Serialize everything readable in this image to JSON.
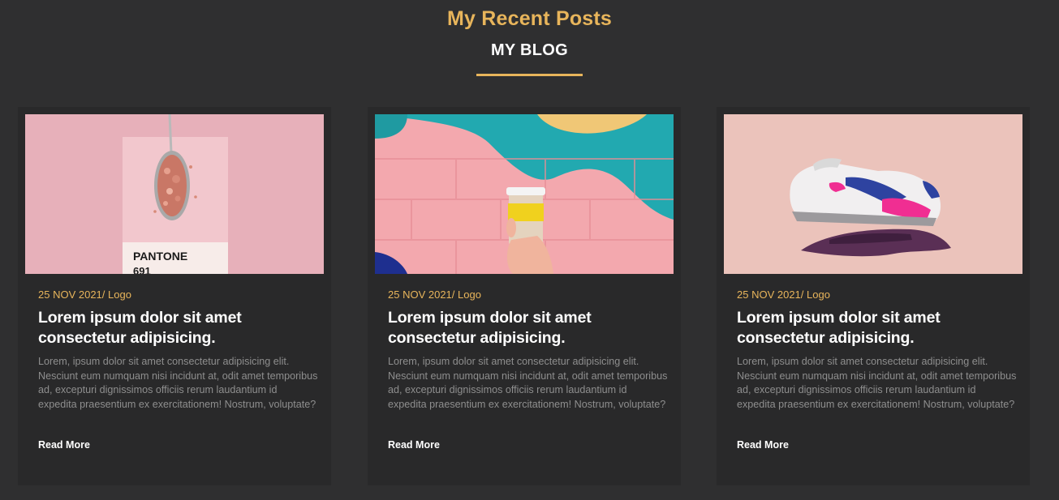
{
  "header": {
    "title": "My Recent Posts",
    "subtitle": "MY BLOG"
  },
  "colors": {
    "accent": "#e8b55b",
    "background": "#2f2f30",
    "card": "#29292a",
    "text_muted": "#8e8e8e"
  },
  "posts": [
    {
      "image": "pantone-spoon-photo",
      "image_text": {
        "brand": "PANTONE",
        "code": "691"
      },
      "meta": "25 NOV 2021/ Logo",
      "title": "Lorem ipsum dolor sit amet consectetur adipisicing.",
      "excerpt": "Lorem, ipsum dolor sit amet consectetur adipisicing elit. Nesciunt eum numquam nisi incidunt at, odit amet temporibus ad, excepturi dignissimos officiis rerum laudantium id expedita praesentium ex exercitationem! Nostrum, voluptate?",
      "read_more": "Read More"
    },
    {
      "image": "coffee-cup-wall-photo",
      "meta": "25 NOV 2021/ Logo",
      "title": "Lorem ipsum dolor sit amet consectetur adipisicing.",
      "excerpt": "Lorem, ipsum dolor sit amet consectetur adipisicing elit. Nesciunt eum numquam nisi incidunt at, odit amet temporibus ad, excepturi dignissimos officiis rerum laudantium id expedita praesentium ex exercitationem! Nostrum, voluptate?",
      "read_more": "Read More"
    },
    {
      "image": "sneaker-hand-photo",
      "meta": "25 NOV 2021/ Logo",
      "title": "Lorem ipsum dolor sit amet consectetur adipisicing.",
      "excerpt": "Lorem, ipsum dolor sit amet consectetur adipisicing elit. Nesciunt eum numquam nisi incidunt at, odit amet temporibus ad, excepturi dignissimos officiis rerum laudantium id expedita praesentium ex exercitationem! Nostrum, voluptate?",
      "read_more": "Read More"
    }
  ]
}
